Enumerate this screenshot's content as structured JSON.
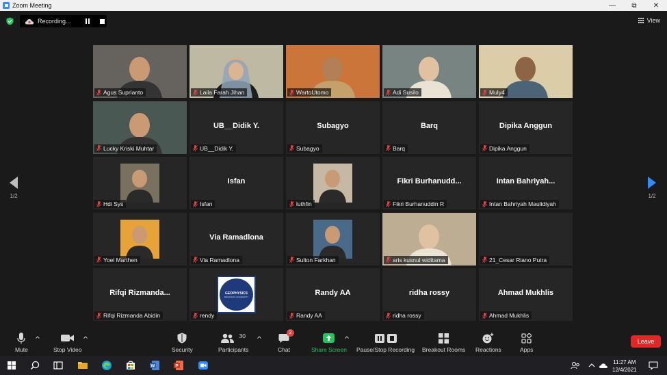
{
  "window": {
    "title": "Zoom Meeting"
  },
  "recording": {
    "label": "Recording..."
  },
  "view": {
    "label": "View"
  },
  "pager": {
    "prev": "1/2",
    "next": "1/2"
  },
  "participants": [
    {
      "name": "Agus Suprianto",
      "display": "",
      "video": true,
      "bg": "#5a5550"
    },
    {
      "name": "Laila Farah Jihan",
      "display": "",
      "video": true,
      "bg": "#b9b39c",
      "active": true
    },
    {
      "name": "WartoUtomo",
      "display": "",
      "video": true,
      "bg": "#c86a2a"
    },
    {
      "name": "Adi Susilo",
      "display": "",
      "video": true,
      "bg": "#6d7a78"
    },
    {
      "name": "Muly4",
      "display": "",
      "video": true,
      "bg": "#d8c9a0"
    },
    {
      "name": "Lucky Kriski Muhtar",
      "display": "",
      "video": true,
      "bg": "#3a4a44"
    },
    {
      "name": "UB__Didik Y.",
      "display": "UB__Didik Y.",
      "video": false
    },
    {
      "name": "Subagyo",
      "display": "Subagyo",
      "video": false
    },
    {
      "name": "Barq",
      "display": "Barq",
      "video": false
    },
    {
      "name": "Dipika Anggun",
      "display": "Dipika Anggun",
      "video": false
    },
    {
      "name": "Hdi Sys",
      "display": "",
      "video": false,
      "avatar": true,
      "avbg": "#7a7060"
    },
    {
      "name": "Isfan",
      "display": "Isfan",
      "video": false
    },
    {
      "name": "luthfin",
      "display": "",
      "video": false,
      "avatar": true,
      "avbg": "#c7b8a6"
    },
    {
      "name": "Fikri Burhanuddin R",
      "display": "Fikri  Burhanudd...",
      "video": false
    },
    {
      "name": "Intan Bahriyah Maulidiyah",
      "display": "Intan  Bahriyah...",
      "video": false
    },
    {
      "name": "Yoel Marthen",
      "display": "",
      "video": false,
      "avatar": true,
      "avbg": "#e8a23a"
    },
    {
      "name": "Via Ramadlona",
      "display": "Via Ramadlona",
      "video": false
    },
    {
      "name": "Sulton Farkhan",
      "display": "",
      "video": false,
      "avatar": true,
      "avbg": "#4a6a8a"
    },
    {
      "name": "aris kusnul widitama",
      "display": "",
      "video": true,
      "bg": "#b8a68a"
    },
    {
      "name": "21_Cesar Riano Putra",
      "display": "",
      "video": false
    },
    {
      "name": "Rifqi Rizmanda Abidin",
      "display": "Rifqi  Rizmanda...",
      "video": false
    },
    {
      "name": "rendy",
      "display": "",
      "video": false,
      "avatar": true,
      "avbg": "#1e3a7a",
      "logo": true
    },
    {
      "name": "Randy AA",
      "display": "Randy AA",
      "video": false
    },
    {
      "name": "ridha rossy",
      "display": "ridha rossy",
      "video": false
    },
    {
      "name": "Ahmad Mukhlis",
      "display": "Ahmad Mukhlis",
      "video": false
    }
  ],
  "logo_text": {
    "top": "GEOPHYSICS",
    "bottom": "BRAWIJAYA UNIVERSITY"
  },
  "toolbar": {
    "mute": "Mute",
    "stop_video": "Stop Video",
    "security": "Security",
    "participants": "Participants",
    "participants_count": "30",
    "chat": "Chat",
    "chat_badge": "2",
    "share_screen": "Share Screen",
    "pause_stop_recording": "Pause/Stop Recording",
    "breakout_rooms": "Breakout Rooms",
    "reactions": "Reactions",
    "apps": "Apps",
    "leave": "Leave"
  },
  "clock": {
    "time": "11:27 AM",
    "date": "12/4/2021"
  },
  "colors": {
    "accent": "#2d8cff",
    "active_speaker": "#c6d85a",
    "share_green": "#23c55e",
    "leave_red": "#e02828",
    "muted_red": "#e04343"
  }
}
